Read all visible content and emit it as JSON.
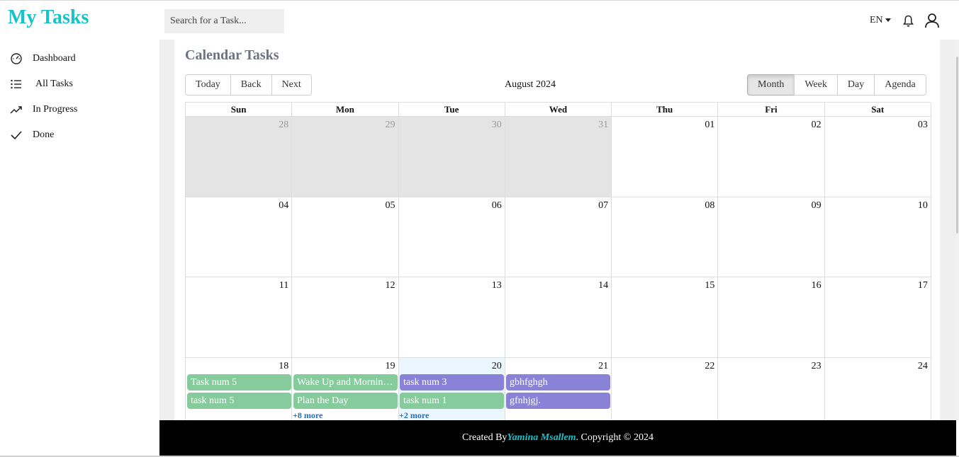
{
  "app": {
    "title": "My Tasks"
  },
  "search": {
    "placeholder": "Search for a Task..."
  },
  "header": {
    "language": "EN"
  },
  "sidebar": {
    "items": [
      {
        "label": "Dashboard",
        "icon": "gauge-icon"
      },
      {
        "label": "All Tasks",
        "icon": "list-icon"
      },
      {
        "label": "In Progress",
        "icon": "trend-up-icon"
      },
      {
        "label": "Done",
        "icon": "check-icon"
      }
    ]
  },
  "main": {
    "title": "Calendar Tasks",
    "nav_buttons": [
      "Today",
      "Back",
      "Next"
    ],
    "current_label": "August 2024",
    "view_buttons": [
      "Month",
      "Week",
      "Day",
      "Agenda"
    ],
    "active_view": "Month",
    "weekdays": [
      "Sun",
      "Mon",
      "Tue",
      "Wed",
      "Thu",
      "Fri",
      "Sat"
    ],
    "weeks": [
      [
        "28",
        "29",
        "30",
        "31",
        "01",
        "02",
        "03"
      ],
      [
        "04",
        "05",
        "06",
        "07",
        "08",
        "09",
        "10"
      ],
      [
        "11",
        "12",
        "13",
        "14",
        "15",
        "16",
        "17"
      ],
      [
        "18",
        "19",
        "20",
        "21",
        "22",
        "23",
        "24"
      ]
    ],
    "events": {
      "sun18": [
        "Task num 5",
        "task num 5"
      ],
      "mon19": [
        "Wake Up and Morning Routine",
        "Plan the Day"
      ],
      "tue20": [
        "task num 3",
        "task num 1"
      ],
      "wed21": [
        "gbhfghgh",
        "gfnhjgj."
      ]
    },
    "more_mon": "+8 more",
    "more_tue": "+2 more"
  },
  "footer": {
    "prefix": "Created By",
    "author": "Yamina Msallem",
    "suffix": ". Copyright © 2024"
  },
  "colors": {
    "brand": "#17c3c9",
    "event_green": "#85cb9c",
    "event_purple": "#8a82d6",
    "today_bg": "#eaf6fd",
    "offrange_bg": "#e4e4e4"
  }
}
